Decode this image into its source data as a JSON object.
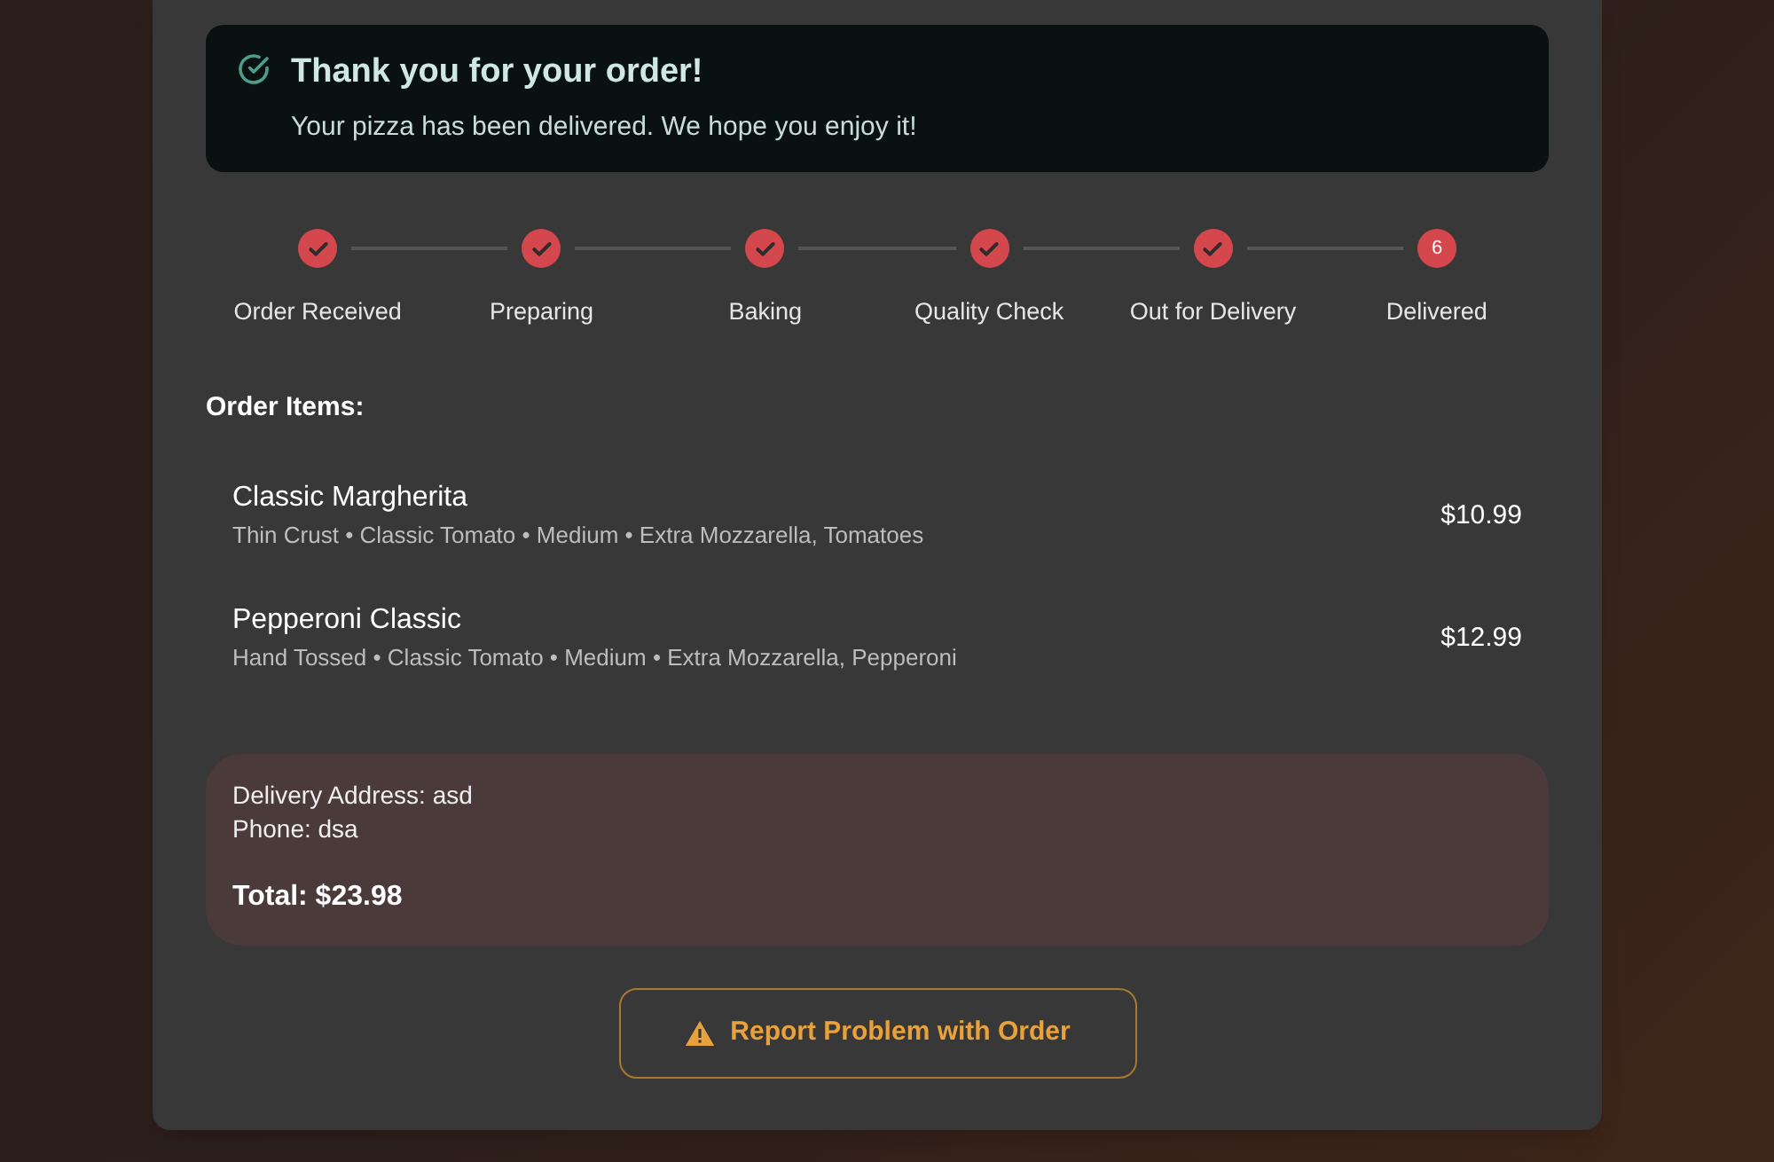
{
  "success_banner": {
    "title": "Thank you for your order!",
    "message": "Your pizza has been delivered. We hope you enjoy it!"
  },
  "progress_steps": [
    {
      "label": "Order Received",
      "completed": true
    },
    {
      "label": "Preparing",
      "completed": true
    },
    {
      "label": "Baking",
      "completed": true
    },
    {
      "label": "Quality Check",
      "completed": true
    },
    {
      "label": "Out for Delivery",
      "completed": true
    },
    {
      "label": "Delivered",
      "completed": false,
      "number": "6"
    }
  ],
  "order_items": {
    "heading": "Order Items:",
    "items": [
      {
        "name": "Classic Margherita",
        "details": "Thin Crust • Classic Tomato • Medium • Extra Mozzarella, Tomatoes",
        "price": "$10.99"
      },
      {
        "name": "Pepperoni Classic",
        "details": "Hand Tossed • Classic Tomato • Medium • Extra Mozzarella, Pepperoni",
        "price": "$12.99"
      }
    ]
  },
  "delivery_info": {
    "address": "Delivery Address: asd",
    "phone": "Phone: dsa",
    "total": "Total: $23.98"
  },
  "report_button": {
    "label": "Report Problem with Order"
  }
}
